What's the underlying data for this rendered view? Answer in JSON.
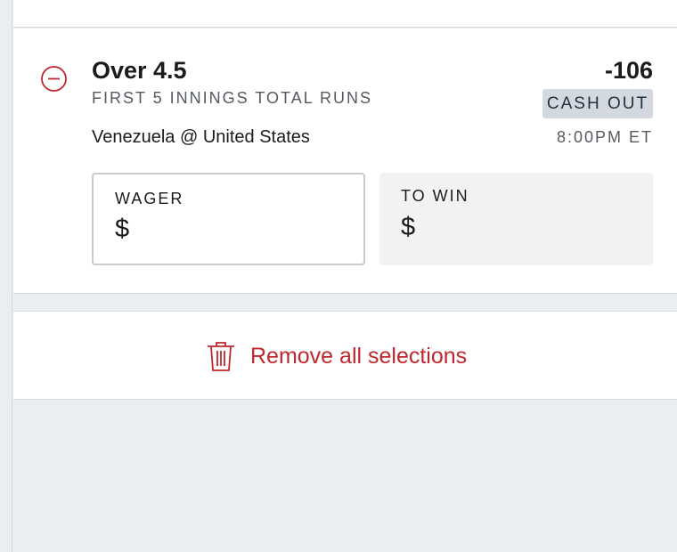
{
  "bet": {
    "pick": "Over 4.5",
    "market": "FIRST 5 INNINGS TOTAL RUNS",
    "matchup": "Venezuela @ United States",
    "odds": "-106",
    "cashout_label": "CASH OUT",
    "time": "8:00PM ET",
    "wager": {
      "label": "WAGER",
      "value": "$"
    },
    "to_win": {
      "label": "TO WIN",
      "value": "$"
    }
  },
  "actions": {
    "remove_all_label": "Remove all selections"
  },
  "icons": {
    "remove_selection": "minus-circle-icon",
    "remove_all": "trash-icon"
  },
  "colors": {
    "accent": "#c0272d",
    "cashout_bg": "#d3d9df",
    "page_bg": "#ebeef1"
  }
}
